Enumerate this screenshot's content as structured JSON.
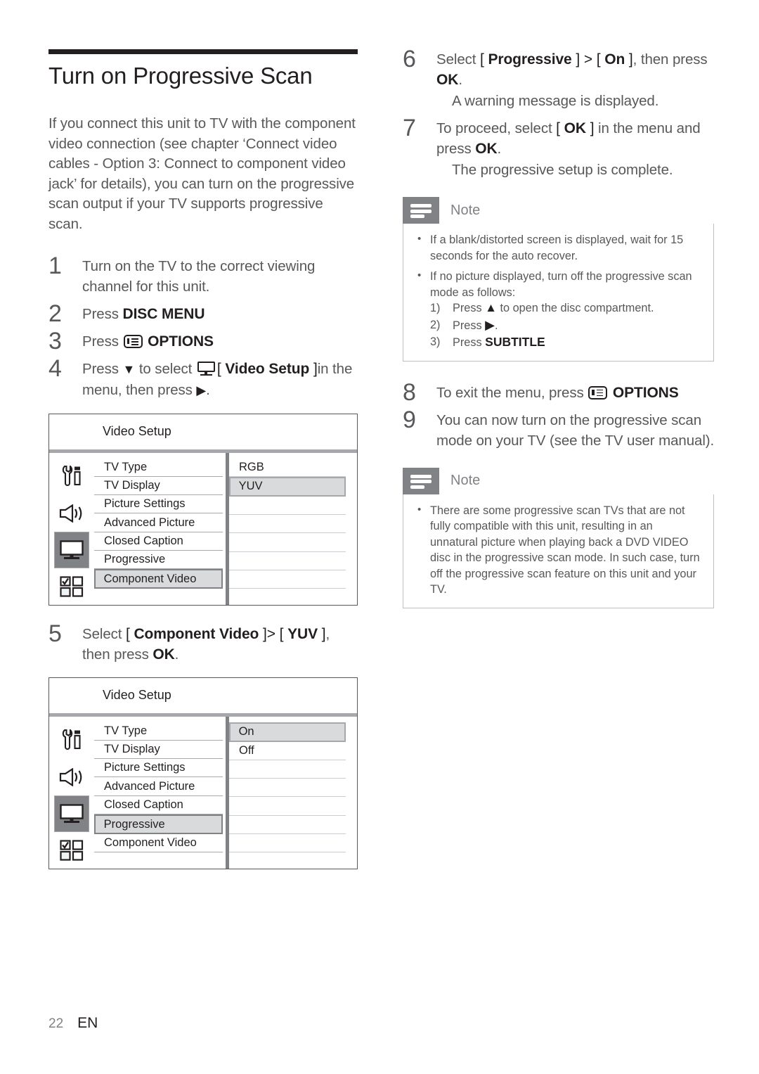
{
  "document": {
    "title": "Turn on Progressive Scan",
    "intro": "If you connect this unit to TV with the component video connection (see chapter ‘Connect video cables - Option 3: Connect to component video jack’ for details), you can turn on the progressive scan output if your TV supports progressive scan."
  },
  "steps": {
    "s1": {
      "num": "1",
      "text": "Turn on the TV to the correct viewing channel for this unit."
    },
    "s2": {
      "num": "2",
      "pre": "Press ",
      "key": "DISC MENU"
    },
    "s3": {
      "num": "3",
      "pre": "Press ",
      "icon": "options-icon",
      "key": "OPTIONS"
    },
    "s4": {
      "num": "4",
      "pre": "Press ",
      "arrow": "▼",
      "mid": " to select ",
      "icon": "tv-monitor-icon",
      "open": "[ ",
      "bracketed": "Video Setup",
      "close": " ]",
      "post": "in the menu, then press ",
      "arrow2": "▶",
      "period": "."
    },
    "s5": {
      "num": "5",
      "pre": "Select ",
      "open": "[ ",
      "item1": "Component Video",
      "close": " ]",
      "gt": "> ",
      "open2": "[ ",
      "item2": "YUV",
      "close2": " ]",
      "tail": ", then press ",
      "key": "OK",
      "period": "."
    },
    "s6": {
      "num": "6",
      "pre": "Select ",
      "open": "[ ",
      "item1": "Progressive",
      "close": " ]",
      "gt": " > ",
      "open2": "[ ",
      "item2": "On",
      "close2": " ]",
      "tail": ", then press ",
      "key": "OK",
      "period": ".",
      "sub": "A warning message is displayed."
    },
    "s7": {
      "num": "7",
      "pre": "To proceed, select ",
      "open": "[ ",
      "item1": "OK",
      "close": " ]",
      "mid": " in the menu and press ",
      "key": "OK",
      "period": ".",
      "sub": "The progressive setup is complete."
    },
    "s8": {
      "num": "8",
      "pre": "To exit the menu, press ",
      "icon": "options-icon",
      "key": "OPTIONS"
    },
    "s9": {
      "num": "9",
      "text": "You can now turn on the progressive scan mode on your TV (see the TV user manual)."
    }
  },
  "menu_screens": [
    {
      "title": "Video Setup",
      "icons": [
        {
          "name": "general-setup-icon",
          "selected": false
        },
        {
          "name": "audio-setup-icon",
          "selected": false
        },
        {
          "name": "video-setup-icon",
          "selected": true
        },
        {
          "name": "preference-setup-icon",
          "selected": false
        }
      ],
      "items": [
        "TV Type",
        "TV Display",
        "Picture Settings",
        "Advanced Picture",
        "Closed Caption",
        "Progressive",
        "Component Video"
      ],
      "selected_item": "Component Video",
      "values": [
        "RGB",
        "YUV"
      ],
      "selected_value": "YUV"
    },
    {
      "title": "Video Setup",
      "icons": [
        {
          "name": "general-setup-icon",
          "selected": false
        },
        {
          "name": "audio-setup-icon",
          "selected": false
        },
        {
          "name": "video-setup-icon",
          "selected": true
        },
        {
          "name": "preference-setup-icon",
          "selected": false
        }
      ],
      "items": [
        "TV Type",
        "TV Display",
        "Picture Settings",
        "Advanced Picture",
        "Closed Caption",
        "Progressive",
        "Component Video"
      ],
      "selected_item": "Progressive",
      "values": [
        "On",
        "Off"
      ],
      "selected_value": "On"
    }
  ],
  "notes": [
    {
      "label": "Note",
      "bullets": [
        "If a blank/distorted screen is displayed, wait for 15 seconds for the auto recover.",
        "If no picture displayed, turn off the progressive scan mode as follows:"
      ],
      "sub_items": [
        {
          "num": "1)",
          "pre": "Press ",
          "icon": "▲",
          "post": " to open the disc compartment."
        },
        {
          "num": "2)",
          "pre": "Press ",
          "icon": "▶",
          "post": "."
        },
        {
          "num": "3)",
          "pre": "Press ",
          "key": "SUBTITLE",
          "post": ""
        }
      ]
    },
    {
      "label": "Note",
      "bullets": [
        "There are some progressive scan TVs that are not fully compatible with this unit, resulting in an unnatural picture when playing back a DVD VIDEO disc in the progressive scan mode. In such case, turn off the progressive scan feature on this unit and your TV."
      ]
    }
  ],
  "footer": {
    "page_number": "22",
    "language": "EN"
  },
  "colors": {
    "text_body": "#58585a",
    "text_dark": "#231f20",
    "accent_grey": "#808285",
    "highlight_fill": "#d9dadb",
    "rule_dark": "#231f20"
  }
}
